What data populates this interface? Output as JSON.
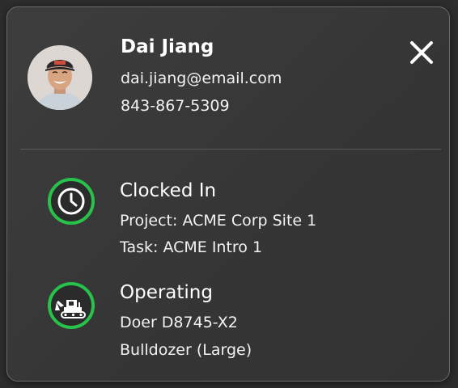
{
  "user": {
    "name": "Dai Jiang",
    "email": "dai.jiang@email.com",
    "phone": "843-867-5309"
  },
  "status": {
    "clocked_in": {
      "title": "Clocked In",
      "project": "Project: ACME Corp Site 1",
      "task": "Task: ACME Intro 1",
      "icon": "clock-icon"
    },
    "operating": {
      "title": "Operating",
      "equipment": "Doer D8745-X2",
      "type": "Bulldozer (Large)",
      "icon": "bulldozer-icon"
    }
  },
  "colors": {
    "status_ring": "#27c24a",
    "card_background": "#3a3a3a",
    "text": "#ffffff"
  },
  "close_icon": "close-icon"
}
